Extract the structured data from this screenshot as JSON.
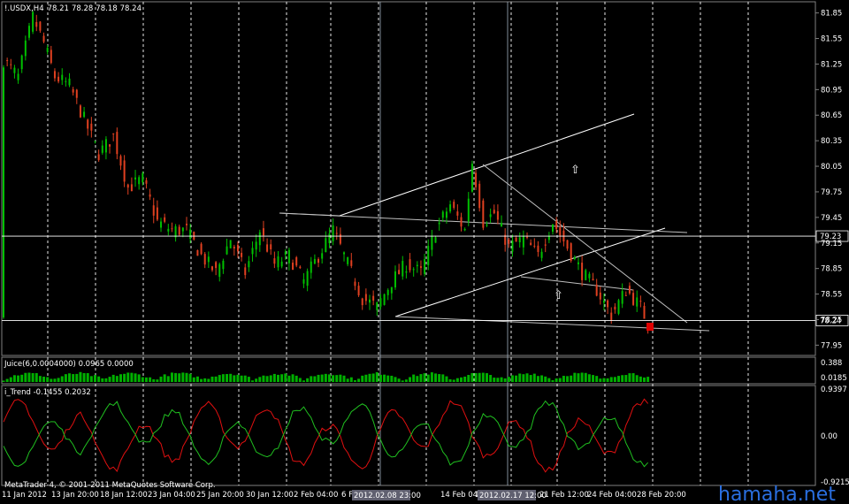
{
  "chart_data": [
    {
      "type": "candlestick",
      "title": "!.USDX,H4",
      "ohlc": [
        "78.21",
        "78.28",
        "78.18",
        "78.24"
      ],
      "ylim": [
        77.85,
        81.95
      ],
      "y_ticks": [
        "81.85",
        "81.55",
        "81.25",
        "80.95",
        "80.65",
        "80.35",
        "80.05",
        "79.75",
        "79.45",
        "79.15",
        "78.85",
        "78.55",
        "78.25",
        "77.95"
      ],
      "x_ticks": [
        "11 Jan 2012",
        "13 Jan 20:00",
        "18 Jan 12:00",
        "23 Jan 04:00",
        "25 Jan 20:00",
        "30 Jan 12:00",
        "2 Feb 04:00",
        "6 Feb",
        "9 Feb",
        "14 Feb 04:00",
        "16 Feb",
        "21 Feb 12:00",
        "24 Feb 04:00",
        "28 Feb 20:00"
      ],
      "price_markers": [
        {
          "label": "79.23",
          "value": 79.23
        },
        {
          "label": "78.24",
          "value": 78.24
        }
      ],
      "vertical_markers": [
        "2012.02.08 23:00",
        "2012.02.17 12:00"
      ],
      "close_path": [
        [
          0,
          81.3
        ],
        [
          4,
          81.1
        ],
        [
          8,
          81.8
        ],
        [
          11,
          81.5
        ],
        [
          14,
          81.1
        ],
        [
          18,
          81.0
        ],
        [
          22,
          80.6
        ],
        [
          26,
          80.2
        ],
        [
          30,
          80.4
        ],
        [
          34,
          79.8
        ],
        [
          38,
          79.9
        ],
        [
          42,
          79.4
        ],
        [
          46,
          79.3
        ],
        [
          50,
          79.3
        ],
        [
          54,
          79.0
        ],
        [
          58,
          78.8
        ],
        [
          62,
          79.2
        ],
        [
          66,
          78.8
        ],
        [
          70,
          79.3
        ],
        [
          74,
          78.9
        ],
        [
          78,
          79.0
        ],
        [
          82,
          78.7
        ],
        [
          86,
          79.0
        ],
        [
          90,
          79.3
        ],
        [
          94,
          78.9
        ],
        [
          98,
          78.5
        ],
        [
          102,
          78.4
        ],
        [
          106,
          78.7
        ],
        [
          110,
          78.9
        ],
        [
          114,
          78.8
        ],
        [
          118,
          79.3
        ],
        [
          122,
          79.6
        ],
        [
          126,
          79.3
        ],
        [
          128,
          80.1
        ],
        [
          131,
          79.4
        ],
        [
          134,
          79.5
        ],
        [
          138,
          79.1
        ],
        [
          142,
          79.2
        ],
        [
          146,
          79.0
        ],
        [
          150,
          79.4
        ],
        [
          154,
          79.1
        ],
        [
          158,
          78.8
        ],
        [
          162,
          78.6
        ],
        [
          166,
          78.3
        ],
        [
          170,
          78.6
        ],
        [
          174,
          78.4
        ],
        [
          176,
          78.2
        ]
      ],
      "n_bars": 177
    },
    {
      "type": "bar",
      "title": "Juice(6,0.0004000) 0.0965 0.0000",
      "ylim": [
        0,
        0.388
      ],
      "y_ticks": [
        "0.388",
        "0.0185"
      ]
    },
    {
      "type": "line",
      "title": "i_Trend -0.1455 0.2032",
      "ylim": [
        -0.9215,
        0.9397
      ],
      "y_ticks": [
        "0.9397",
        "0.00",
        "-0.9215"
      ]
    }
  ],
  "footer": {
    "copyright": "MetaTrader 4, © 2001-2011 MetaQuotes Software Corp.",
    "watermark": "hamaha.net"
  },
  "colors": {
    "bull": "#00c000",
    "bear": "#e04020",
    "grid": "#ffffff",
    "red_line": "#e01010",
    "green_line": "#20c020",
    "watermark": "#2a6fe0"
  }
}
